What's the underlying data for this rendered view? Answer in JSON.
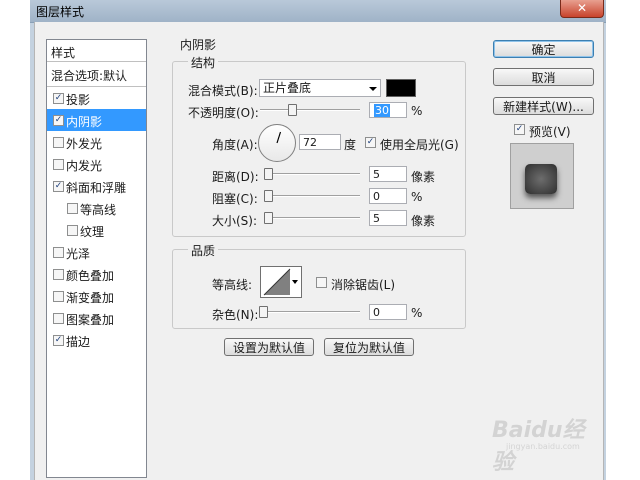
{
  "window": {
    "title": "图层样式",
    "close_symbol": "✕"
  },
  "styles_list": {
    "header": "样式",
    "blend_defaults": "混合选项:默认",
    "items": [
      {
        "label": "投影",
        "checked": true,
        "selected": false
      },
      {
        "label": "内阴影",
        "checked": true,
        "selected": true
      },
      {
        "label": "外发光",
        "checked": false,
        "selected": false
      },
      {
        "label": "内发光",
        "checked": false,
        "selected": false
      },
      {
        "label": "斜面和浮雕",
        "checked": true,
        "selected": false
      },
      {
        "label": "等高线",
        "checked": false,
        "selected": false,
        "indent": true
      },
      {
        "label": "纹理",
        "checked": false,
        "selected": false,
        "indent": true
      },
      {
        "label": "光泽",
        "checked": false,
        "selected": false
      },
      {
        "label": "颜色叠加",
        "checked": false,
        "selected": false
      },
      {
        "label": "渐变叠加",
        "checked": false,
        "selected": false
      },
      {
        "label": "图案叠加",
        "checked": false,
        "selected": false
      },
      {
        "label": "描边",
        "checked": true,
        "selected": false
      }
    ]
  },
  "panel": {
    "title": "内阴影",
    "structure": {
      "title": "结构",
      "blend_mode_label": "混合模式(B):",
      "blend_mode_value": "正片叠底",
      "color_swatch": "#000000",
      "opacity_label": "不透明度(O):",
      "opacity_value": "30",
      "opacity_unit": "%",
      "angle_label": "角度(A):",
      "angle_value": "72",
      "angle_unit": "度",
      "global_light_label": "使用全局光(G)",
      "global_light_checked": true,
      "distance_label": "距离(D):",
      "distance_value": "5",
      "distance_unit": "像素",
      "choke_label": "阻塞(C):",
      "choke_value": "0",
      "choke_unit": "%",
      "size_label": "大小(S):",
      "size_value": "5",
      "size_unit": "像素"
    },
    "quality": {
      "title": "品质",
      "contour_label": "等高线:",
      "antialias_label": "消除锯齿(L)",
      "antialias_checked": false,
      "noise_label": "杂色(N):",
      "noise_value": "0",
      "noise_unit": "%"
    },
    "set_default_label": "设置为默认值",
    "reset_default_label": "复位为默认值"
  },
  "actions": {
    "ok_label": "确定",
    "cancel_label": "取消",
    "new_style_label": "新建样式(W)...",
    "preview_label": "预览(V)",
    "preview_checked": true
  },
  "watermark": {
    "text": "Baidu经验",
    "sub": "jingyan.baidu.com"
  },
  "colors": {
    "selection": "#3399ff",
    "title_bar": "#a8bacd",
    "close_button": "#c8432c"
  },
  "icons": {
    "check": "check-icon",
    "dropdown": "chevron-down-icon",
    "angle_dial": "angle-dial-icon",
    "contour": "contour-curve-icon"
  }
}
